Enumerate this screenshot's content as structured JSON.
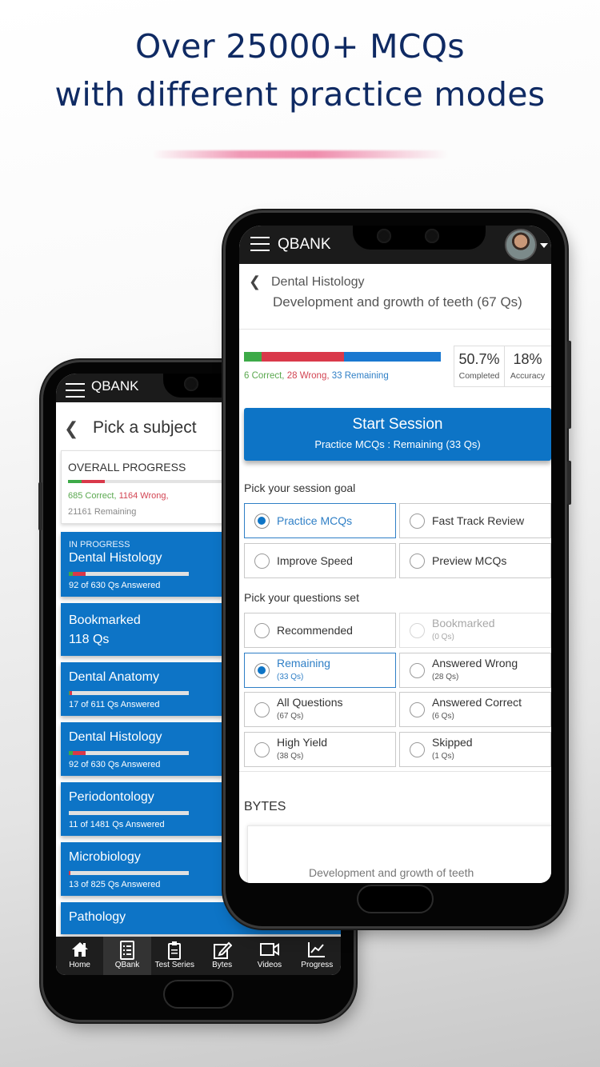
{
  "headline": {
    "line1": "Over 25000+ MCQs",
    "line2": "with different practice modes"
  },
  "colors": {
    "headline": "#0f2a63",
    "brand_blue": "#0d74c6",
    "correct_green": "#3daa48",
    "wrong_red": "#d9394a",
    "remaining_blue": "#1a78d0",
    "app_bar": "#1b1b1b",
    "accent_pink": "#ec789e"
  },
  "back_phone": {
    "app_bar": {
      "menu_icon": "hamburger-icon",
      "title": "QBANK"
    },
    "page_title": "Pick a subject",
    "back_icon": "chevron-left-icon",
    "overall_progress": {
      "label": "OVERALL PROGRESS",
      "correct_text": "685 Correct,",
      "wrong_text": "1164 Wrong,",
      "remaining_text": "21161 Remaining",
      "correct": 685,
      "wrong": 1164,
      "remaining": 21161
    },
    "subjects": [
      {
        "tag": "IN PROGRESS",
        "name": "Dental Histology",
        "subtitle": "92 of 630 Qs Answered",
        "correct_fraction": 0.03,
        "wrong_fraction": 0.11,
        "has_bar": true
      },
      {
        "tag": "",
        "name": "Bookmarked",
        "subtitle": "118 Qs",
        "has_bar": false,
        "big": true
      },
      {
        "tag": "",
        "name": "Dental Anatomy",
        "subtitle": "17 of 611 Qs Answered",
        "correct_fraction": 0.005,
        "wrong_fraction": 0.02,
        "has_bar": true
      },
      {
        "tag": "",
        "name": "Dental Histology",
        "subtitle": "92 of 630 Qs Answered",
        "correct_fraction": 0.03,
        "wrong_fraction": 0.11,
        "has_bar": true
      },
      {
        "tag": "",
        "name": "Periodontology",
        "subtitle": "11 of 1481 Qs Answered",
        "correct_fraction": 0.0,
        "wrong_fraction": 0.0,
        "has_bar": true
      },
      {
        "tag": "",
        "name": "Microbiology",
        "subtitle": "13 of 825 Qs Answered",
        "correct_fraction": 0.0,
        "wrong_fraction": 0.015,
        "has_bar": true
      },
      {
        "tag": "",
        "name": "Pathology",
        "subtitle": "",
        "has_bar": false
      }
    ],
    "bottom_nav": [
      {
        "label": "Home",
        "icon": "home-icon",
        "active": false
      },
      {
        "label": "QBank",
        "icon": "list-icon",
        "active": true
      },
      {
        "label": "Test Series",
        "icon": "clipboard-icon",
        "active": false
      },
      {
        "label": "Bytes",
        "icon": "edit-icon",
        "active": false
      },
      {
        "label": "Videos",
        "icon": "video-icon",
        "active": false
      },
      {
        "label": "Progress",
        "icon": "chart-icon",
        "active": false
      }
    ]
  },
  "front_phone": {
    "app_bar": {
      "menu_icon": "hamburger-icon",
      "title": "QBANK",
      "avatar": "user-avatar",
      "dropdown_icon": "caret-down-icon"
    },
    "breadcrumb": {
      "subject": "Dental Histology",
      "topic": "Development and growth of teeth (67 Qs)"
    },
    "progress": {
      "correct": 6,
      "wrong": 28,
      "remaining": 33,
      "correct_text": "6 Correct,",
      "wrong_text": "28 Wrong,",
      "remaining_text": "33 Remaining"
    },
    "stats": [
      {
        "value": "50.7%",
        "label": "Completed"
      },
      {
        "value": "18%",
        "label": "Accuracy"
      }
    ],
    "start_button": {
      "title": "Start Session",
      "subtitle": "Practice MCQs : Remaining (33 Qs)"
    },
    "session_goal": {
      "label": "Pick your session goal",
      "options": [
        {
          "label": "Practice MCQs",
          "selected": true
        },
        {
          "label": "Fast Track Review",
          "selected": false
        },
        {
          "label": "Improve Speed",
          "selected": false
        },
        {
          "label": "Preview MCQs",
          "selected": false
        }
      ]
    },
    "question_set": {
      "label": "Pick your questions set",
      "options": [
        {
          "label": "Recommended",
          "count": "",
          "selected": false,
          "disabled": false
        },
        {
          "label": "Bookmarked",
          "count": "(0 Qs)",
          "selected": false,
          "disabled": true
        },
        {
          "label": "Remaining",
          "count": "(33 Qs)",
          "selected": true,
          "disabled": false
        },
        {
          "label": "Answered Wrong",
          "count": "(28 Qs)",
          "selected": false,
          "disabled": false
        },
        {
          "label": "All Questions",
          "count": "(67 Qs)",
          "selected": false,
          "disabled": false
        },
        {
          "label": "Answered Correct",
          "count": "(6 Qs)",
          "selected": false,
          "disabled": false
        },
        {
          "label": "High Yield",
          "count": "(38 Qs)",
          "selected": false,
          "disabled": false
        },
        {
          "label": "Skipped",
          "count": "(1 Qs)",
          "selected": false,
          "disabled": false
        }
      ]
    },
    "bytes": {
      "label": "BYTES",
      "card_title": "Development and growth of teeth"
    }
  }
}
